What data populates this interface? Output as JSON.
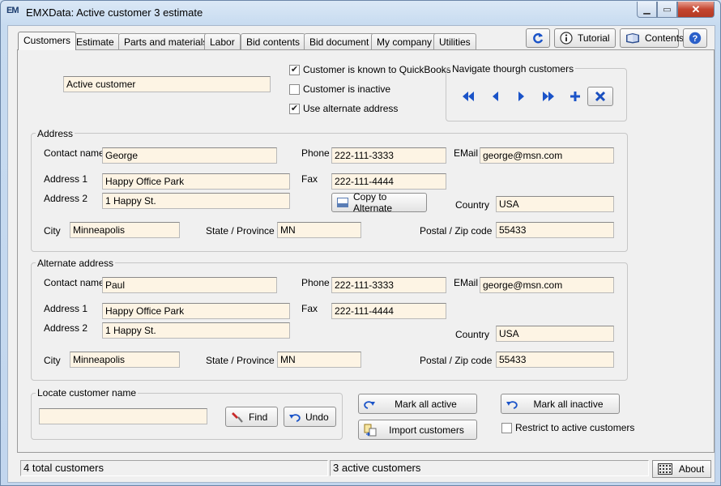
{
  "window": {
    "app_icon_text": "EM",
    "title": "EMXData:  Active customer 3 estimate"
  },
  "tabs": [
    {
      "label": "Customers",
      "active": true
    },
    {
      "label": "Estimate",
      "active": false
    },
    {
      "label": "Parts and materials",
      "active": false
    },
    {
      "label": "Labor",
      "active": false
    },
    {
      "label": "Bid contents",
      "active": false
    },
    {
      "label": "Bid document",
      "active": false
    },
    {
      "label": "My company",
      "active": false
    },
    {
      "label": "Utilities",
      "active": false
    }
  ],
  "toolbar": {
    "refresh_icon": "refresh-icon",
    "tutorial_label": "Tutorial",
    "contents_label": "Contents",
    "help_icon": "help-icon"
  },
  "customer": {
    "active_customer_value": "Active customer",
    "known_quickbooks_label": "Customer is known to QuickBooks",
    "known_quickbooks_checked": true,
    "inactive_label": "Customer is inactive",
    "inactive_checked": false,
    "use_alternate_label": "Use alternate address",
    "use_alternate_checked": true
  },
  "navigate": {
    "title": "Navigate thourgh customers",
    "icons": [
      "first-icon",
      "previous-icon",
      "next-icon",
      "last-icon",
      "add-icon",
      "delete-icon"
    ]
  },
  "address": {
    "title": "Address",
    "contact_label": "Contact name",
    "contact_value": "George",
    "phone_label": "Phone",
    "phone_value": "222-111-3333",
    "email_label": "EMail",
    "email_value": "george@msn.com",
    "address1_label": "Address 1",
    "address1_value": "Happy Office Park",
    "fax_label": "Fax",
    "fax_value": "222-111-4444",
    "address2_label": "Address 2",
    "address2_value": "1 Happy St.",
    "copy_label": "Copy to Alternate",
    "country_label": "Country",
    "country_value": "USA",
    "city_label": "City",
    "city_value": "Minneapolis",
    "state_label": "State / Province",
    "state_value": "MN",
    "zip_label": "Postal / Zip code",
    "zip_value": "55433"
  },
  "alternate": {
    "title": "Alternate address",
    "contact_label": "Contact name",
    "contact_value": "Paul",
    "phone_label": "Phone",
    "phone_value": "222-111-3333",
    "email_label": "EMail",
    "email_value": "george@msn.com",
    "address1_label": "Address 1",
    "address1_value": "Happy Office Park",
    "fax_label": "Fax",
    "fax_value": "222-111-4444",
    "address2_label": "Address 2",
    "address2_value": "1 Happy St.",
    "country_label": "Country",
    "country_value": "USA",
    "city_label": "City",
    "city_value": "Minneapolis",
    "state_label": "State / Province",
    "state_value": "MN",
    "zip_label": "Postal / Zip code",
    "zip_value": "55433"
  },
  "locate": {
    "title": "Locate customer name",
    "search_value": "",
    "find_label": "Find",
    "undo_label": "Undo"
  },
  "actions": {
    "mark_all_active_label": "Mark all active",
    "mark_all_inactive_label": "Mark all inactive",
    "import_label": "Import customers",
    "restrict_label": "Restrict to active customers",
    "restrict_checked": false
  },
  "status": {
    "total_text": "4 total customers",
    "active_text": "3 active customers",
    "about_label": "About"
  },
  "colors": {
    "field_background": "#fdf4e4",
    "nav_arrow_blue": "#1a53c8",
    "delete_blue": "#1a4fbf"
  }
}
